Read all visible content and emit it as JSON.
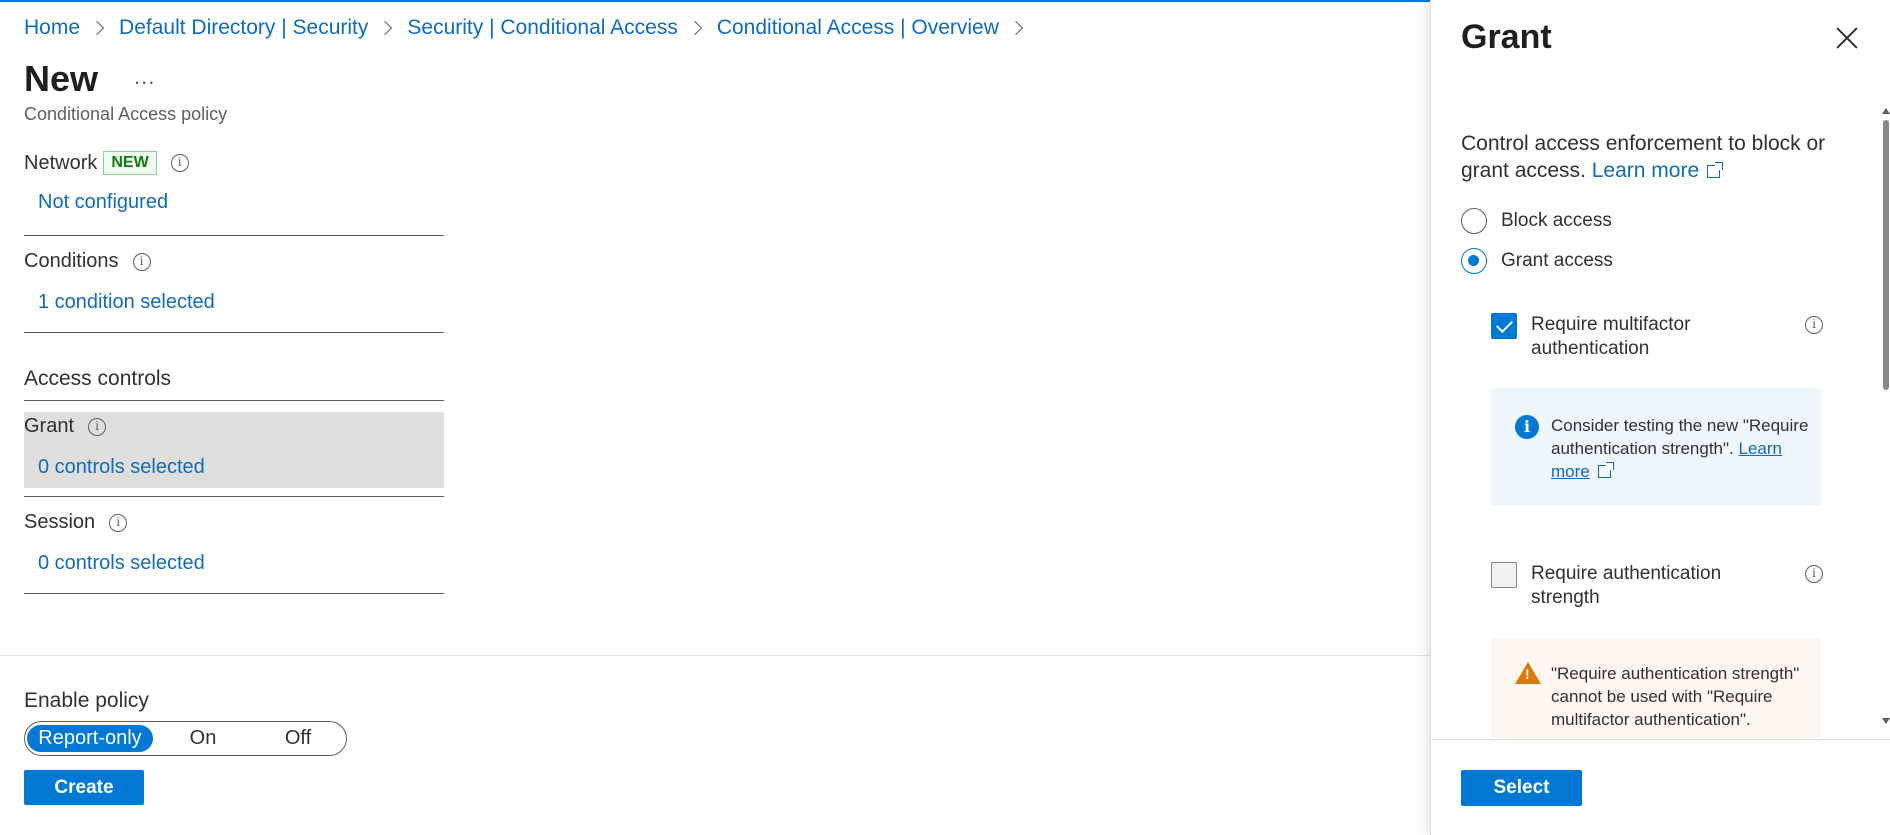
{
  "breadcrumb": [
    {
      "label": "Home"
    },
    {
      "label": "Default Directory | Security"
    },
    {
      "label": "Security | Conditional Access"
    },
    {
      "label": "Conditional Access | Overview"
    }
  ],
  "page": {
    "title": "New",
    "more": "...",
    "subtitle": "Conditional Access policy"
  },
  "network": {
    "label": "Network",
    "badge": "NEW",
    "value": "Not configured"
  },
  "conditions": {
    "label": "Conditions",
    "value": "1 condition selected"
  },
  "access_controls": {
    "heading": "Access controls"
  },
  "grant": {
    "label": "Grant",
    "value": "0 controls selected"
  },
  "session": {
    "label": "Session",
    "value": "0 controls selected"
  },
  "enable_policy": {
    "label": "Enable policy",
    "options": [
      "Report-only",
      "On",
      "Off"
    ],
    "selected": "Report-only"
  },
  "create_label": "Create",
  "panel": {
    "title": "Grant",
    "description": "Control access enforcement to block or grant access.",
    "learn_more": "Learn more",
    "radios": [
      {
        "label": "Block access",
        "checked": false
      },
      {
        "label": "Grant access",
        "checked": true
      }
    ],
    "checks": [
      {
        "label": "Require multifactor authentication",
        "checked": true
      },
      {
        "label": "Require authentication strength",
        "checked": false
      }
    ],
    "info_message": "Consider testing the new \"Require authentication strength\".",
    "info_learn_more": "Learn more",
    "warning_message": "\"Require authentication strength\" cannot be used with \"Require multifactor authentication\".",
    "select_label": "Select"
  },
  "colors": {
    "accent": "#0078d4",
    "link": "#0f6cbd",
    "warning": "#d97a0b",
    "info_bg": "#eff6fc"
  }
}
